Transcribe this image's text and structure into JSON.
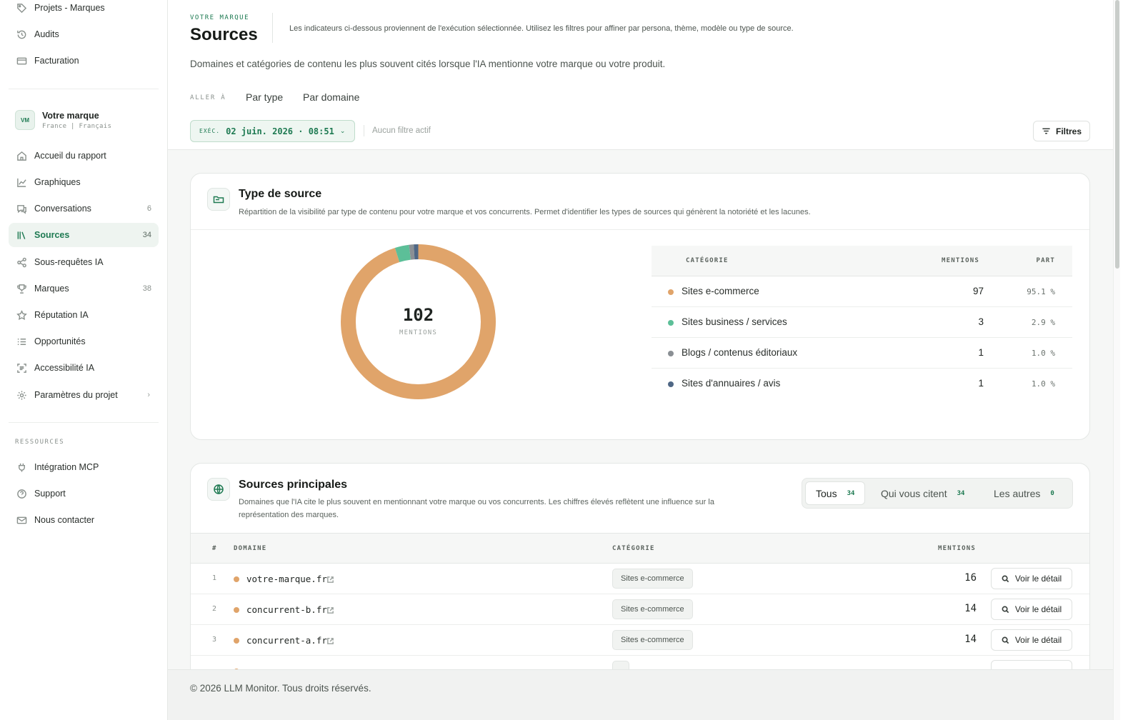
{
  "sidebar": {
    "top_items": [
      {
        "label": "Projets - Marques",
        "icon": "tag-icon"
      },
      {
        "label": "Audits",
        "icon": "history-icon"
      },
      {
        "label": "Facturation",
        "icon": "card-icon"
      }
    ],
    "brand": {
      "initials": "VM",
      "name": "Votre marque",
      "sub": "France | Français"
    },
    "items": [
      {
        "label": "Accueil du rapport",
        "icon": "home-icon",
        "count": ""
      },
      {
        "label": "Graphiques",
        "icon": "chart-icon",
        "count": ""
      },
      {
        "label": "Conversations",
        "icon": "chat-icon",
        "count": "6"
      },
      {
        "label": "Sources",
        "icon": "library-icon",
        "count": "34",
        "active": true
      },
      {
        "label": "Sous-requêtes IA",
        "icon": "share-icon",
        "count": ""
      },
      {
        "label": "Marques",
        "icon": "trophy-icon",
        "count": "38"
      },
      {
        "label": "Réputation IA",
        "icon": "star-icon",
        "count": ""
      },
      {
        "label": "Opportunités",
        "icon": "list-icon",
        "count": ""
      },
      {
        "label": "Accessibilité IA",
        "icon": "scan-icon",
        "count": ""
      },
      {
        "label": "Paramètres du projet",
        "icon": "gear-icon",
        "count": ""
      }
    ],
    "resources_title": "RESSOURCES",
    "resources": [
      {
        "label": "Intégration MCP",
        "icon": "plug-icon"
      },
      {
        "label": "Support",
        "icon": "help-icon"
      },
      {
        "label": "Nous contacter",
        "icon": "mail-icon"
      }
    ]
  },
  "header": {
    "eyebrow": "VOTRE MARQUE",
    "title": "Sources",
    "hint": "Les indicateurs ci-dessous proviennent de l'exécution sélectionnée. Utilisez les filtres pour affiner par persona, thème, modèle ou type de source.",
    "description": "Domaines et catégories de contenu les plus souvent cités lorsque l'IA mentionne votre marque ou votre produit.",
    "goto_label": "ALLER À",
    "goto_links": [
      "Par type",
      "Par domaine"
    ],
    "exec_label": "EXÉC.",
    "exec_value": "02 juin. 2026 · 08:51",
    "no_filter": "Aucun filtre actif",
    "filters_button": "Filtres"
  },
  "source_type": {
    "title": "Type de source",
    "subtitle": "Répartition de la visibilité par type de contenu pour votre marque et vos concurrents. Permet d'identifier les types de sources qui génèrent la notoriété et les lacunes.",
    "total": "102",
    "total_label": "MENTIONS",
    "columns": [
      "CATÉGORIE",
      "MENTIONS",
      "PART"
    ],
    "rows": [
      {
        "name": "Sites e-commerce",
        "mentions": "97",
        "share": "95.1 %",
        "color": "#e0a46a"
      },
      {
        "name": "Sites business / services",
        "mentions": "3",
        "share": "2.9 %",
        "color": "#5cbf98"
      },
      {
        "name": "Blogs / contenus éditoriaux",
        "mentions": "1",
        "share": "1.0 %",
        "color": "#8a8f94"
      },
      {
        "name": "Sites d'annuaires / avis",
        "mentions": "1",
        "share": "1.0 %",
        "color": "#4f6785"
      }
    ]
  },
  "chart_data": {
    "type": "pie",
    "categories": [
      "Sites e-commerce",
      "Sites business / services",
      "Blogs / contenus éditoriaux",
      "Sites d'annuaires / avis"
    ],
    "values": [
      97,
      3,
      1,
      1
    ],
    "colors": [
      "#e0a46a",
      "#5cbf98",
      "#8a8f94",
      "#4f6785"
    ],
    "title": ""
  },
  "top_sources": {
    "title": "Sources principales",
    "subtitle_line1": "Domaines que l'IA cite le plus souvent en mentionnant votre marque ou vos concurrents. Les chiffres élevés reflètent une influence sur la",
    "subtitle_line2": "représentation des marques.",
    "tabs": [
      {
        "label": "Tous",
        "count": "34"
      },
      {
        "label": "Qui vous citent",
        "count": "34"
      },
      {
        "label": "Les autres",
        "count": "0"
      }
    ],
    "columns": [
      "#",
      "DOMAINE",
      "CATÉGORIE",
      "MENTIONS"
    ],
    "rows": [
      {
        "rank": "1",
        "domain": "votre-marque.fr",
        "category": "Sites e-commerce",
        "mentions": "16",
        "action": "Voir le détail"
      },
      {
        "rank": "2",
        "domain": "concurrent-b.fr",
        "category": "Sites e-commerce",
        "mentions": "14",
        "action": "Voir le détail"
      },
      {
        "rank": "3",
        "domain": "concurrent-a.fr",
        "category": "Sites e-commerce",
        "mentions": "14",
        "action": "Voir le détail"
      }
    ]
  },
  "footer": {
    "text": "© 2026 LLM Monitor. Tous droits réservés."
  }
}
